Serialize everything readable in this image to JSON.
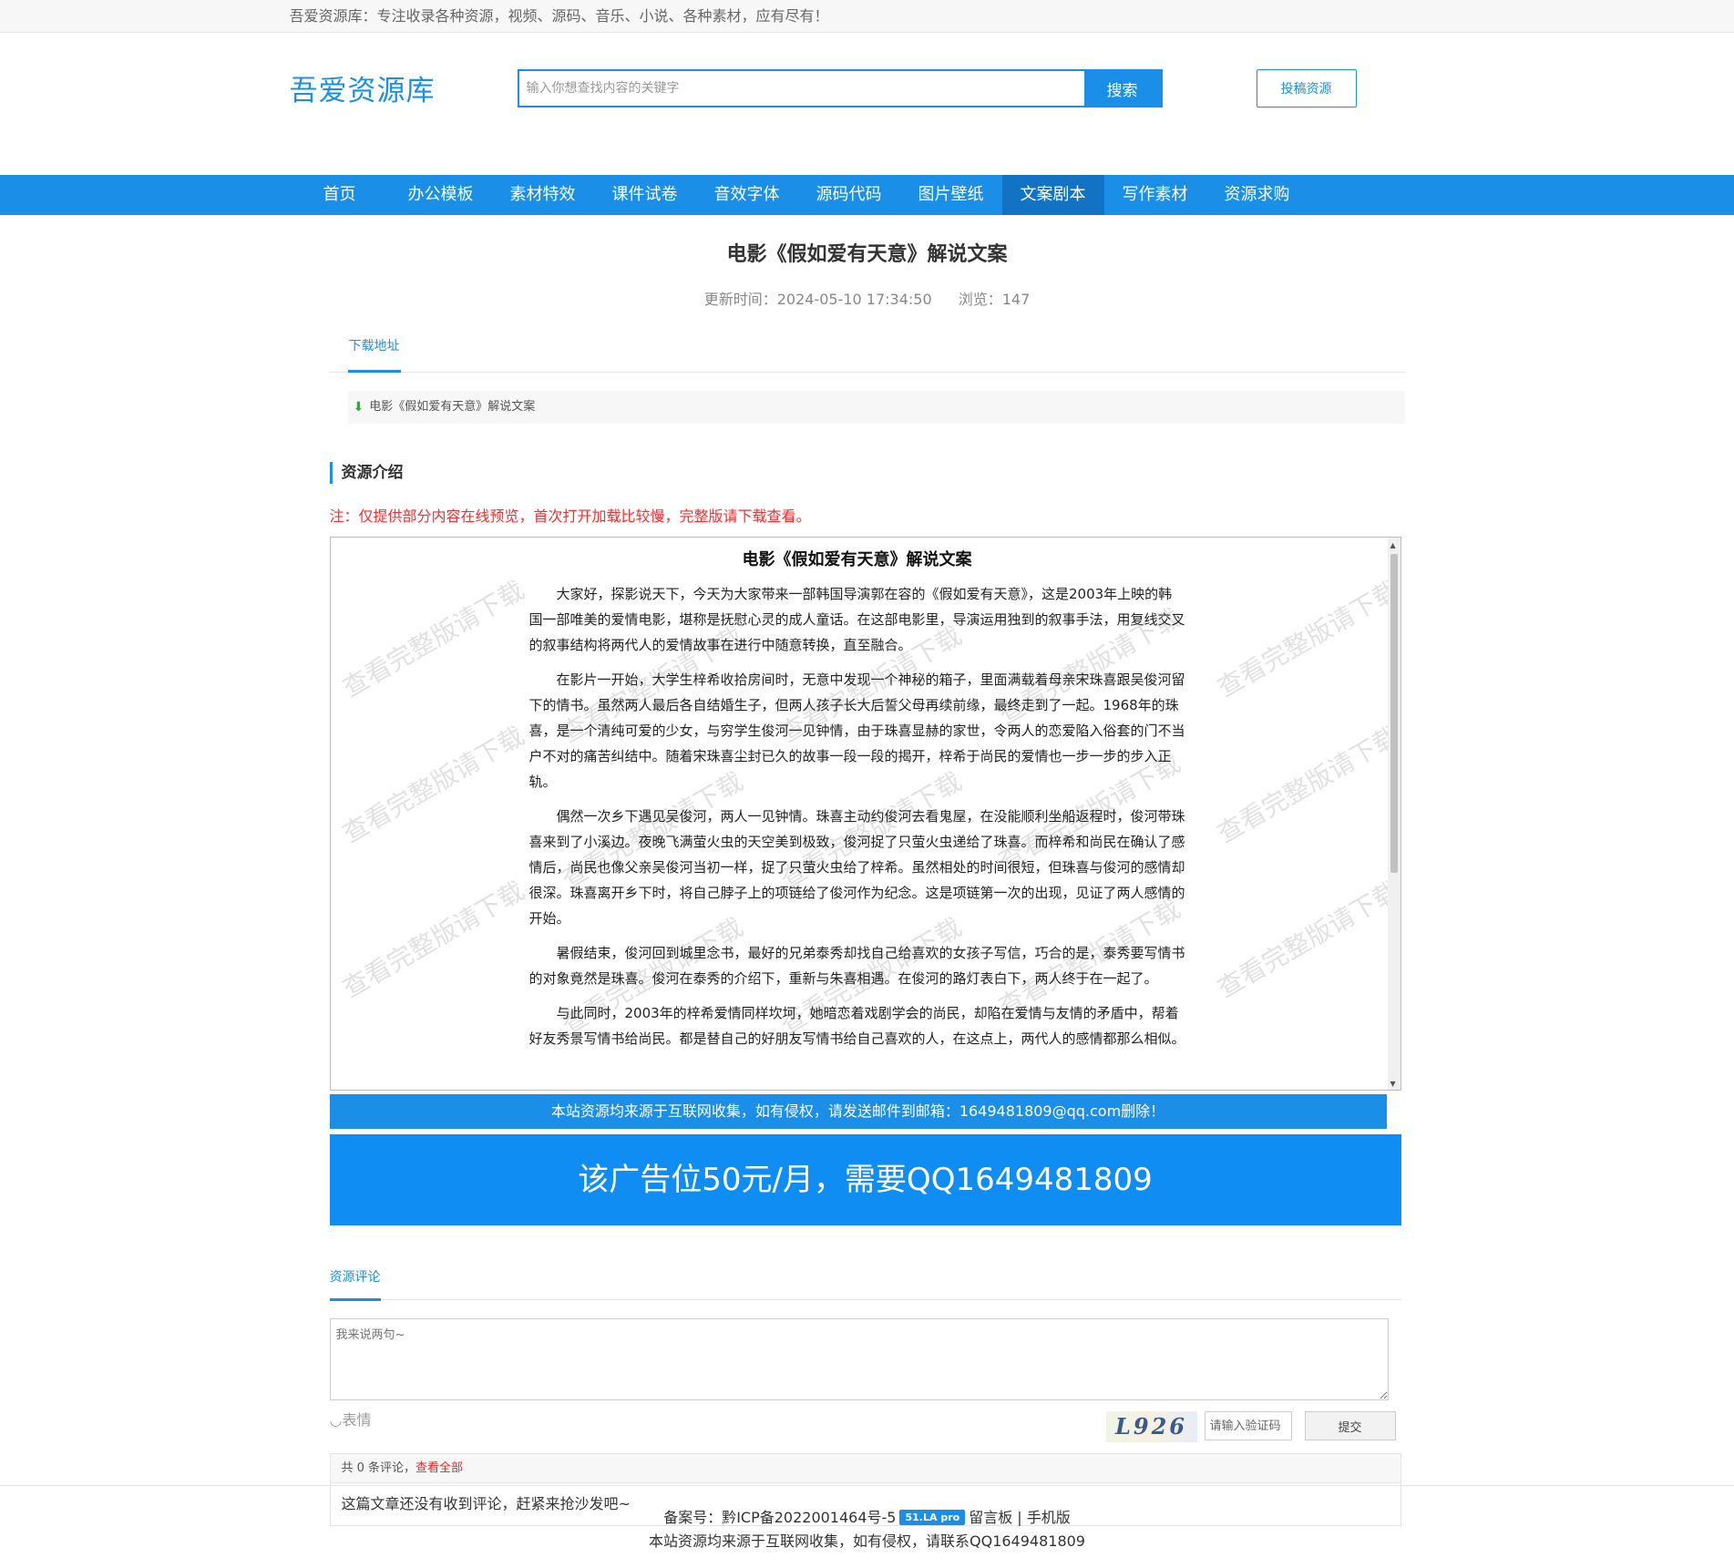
{
  "topbar": {
    "text": "吾爱资源库：专注收录各种资源，视频、源码、音乐、小说、各种素材，应有尽有！"
  },
  "header": {
    "logo": "吾爱资源库",
    "search_placeholder": "输入你想查找内容的关键字",
    "search_button": "搜索",
    "submit_button": "投稿资源"
  },
  "nav": {
    "items": [
      "首页",
      "办公模板",
      "素材特效",
      "课件试卷",
      "音效字体",
      "源码代码",
      "图片壁纸",
      "文案剧本",
      "写作素材",
      "资源求购"
    ],
    "active_index": 7
  },
  "article": {
    "title": "电影《假如爱有天意》解说文案",
    "updated": "更新时间：2024-05-10 17:34:50",
    "views": "浏览：147"
  },
  "download": {
    "tab": "下载地址",
    "link": "电影《假如爱有天意》解说文案"
  },
  "intro": {
    "heading": "资源介绍",
    "note": "注：仅提供部分内容在线预览，首次打开加载比较慢，完整版请下载查看。"
  },
  "preview": {
    "doc_title": "电影《假如爱有天意》解说文案",
    "paragraphs": [
      "大家好，探影说天下，今天为大家带来一部韩国导演郭在容的《假如爱有天意》，这是2003年上映的韩国一部唯美的爱情电影，堪称是抚慰心灵的成人童话。在这部电影里，导演运用独到的叙事手法，用复线交叉的叙事结构将两代人的爱情故事在进行中随意转换，直至融合。",
      "在影片一开始，大学生梓希收拾房间时，无意中发现一个神秘的箱子，里面满载着母亲宋珠喜跟吴俊河留下的情书。虽然两人最后各自结婚生子，但两人孩子长大后誓父母再续前缘，最终走到了一起。1968年的珠喜，是一个清纯可爱的少女，与穷学生俊河一见钟情，由于珠喜显赫的家世，令两人的恋爱陷入俗套的门不当户不对的痛苦纠结中。随着宋珠喜尘封已久的故事一段一段的揭开，梓希于尚民的爱情也一步一步的步入正轨。",
      "偶然一次乡下遇见吴俊河，两人一见钟情。珠喜主动约俊河去看鬼屋，在没能顺利坐船返程时，俊河带珠喜来到了小溪边。夜晚飞满萤火虫的天空美到极致，俊河捉了只萤火虫递给了珠喜。而梓希和尚民在确认了感情后，尚民也像父亲吴俊河当初一样，捉了只萤火虫给了梓希。虽然相处的时间很短，但珠喜与俊河的感情却很深。珠喜离开乡下时，将自己脖子上的项链给了俊河作为纪念。这是项链第一次的出现，见证了两人感情的开始。",
      "暑假结束，俊河回到城里念书，最好的兄弟泰秀却找自己给喜欢的女孩子写信，巧合的是，泰秀要写情书的对象竟然是珠喜。俊河在泰秀的介绍下，重新与朱喜相遇。在俊河的路灯表白下，两人终于在一起了。",
      "与此同时，2003年的梓希爱情同样坎坷，她暗恋着戏剧学会的尚民，却陷在爱情与友情的矛盾中，帮着好友秀景写情书给尚民。都是替自己的好朋友写情书给自己喜欢的人，在这点上，两代人的感情都那么相似。"
    ],
    "watermark": "查看完整版请下载"
  },
  "notice": "本站资源均来源于互联网收集，如有侵权，请发送邮件到邮箱：1649481809@qq.com删除！",
  "ad": "该广告位50元/月，需要QQ1649481809",
  "comments": {
    "tab": "资源评论",
    "placeholder": "我来说两句~",
    "emoji_label": "表情",
    "captcha_text": "L926",
    "captcha_placeholder": "请输入验证码",
    "submit_label": "提交",
    "count_text": "共 0 条评论，",
    "view_all": "查看全部",
    "empty_text": "这篇文章还没有收到评论，赶紧来抢沙发吧~"
  },
  "footer": {
    "icp": "备案号：黔ICP备2022001464号-5",
    "badge": "51.LA pro",
    "guestbook": "留言板",
    "separator": "|",
    "mobile": "手机版",
    "disclaimer": "本站资源均来源于互联网收集，如有侵权，请联系QQ1649481809"
  }
}
